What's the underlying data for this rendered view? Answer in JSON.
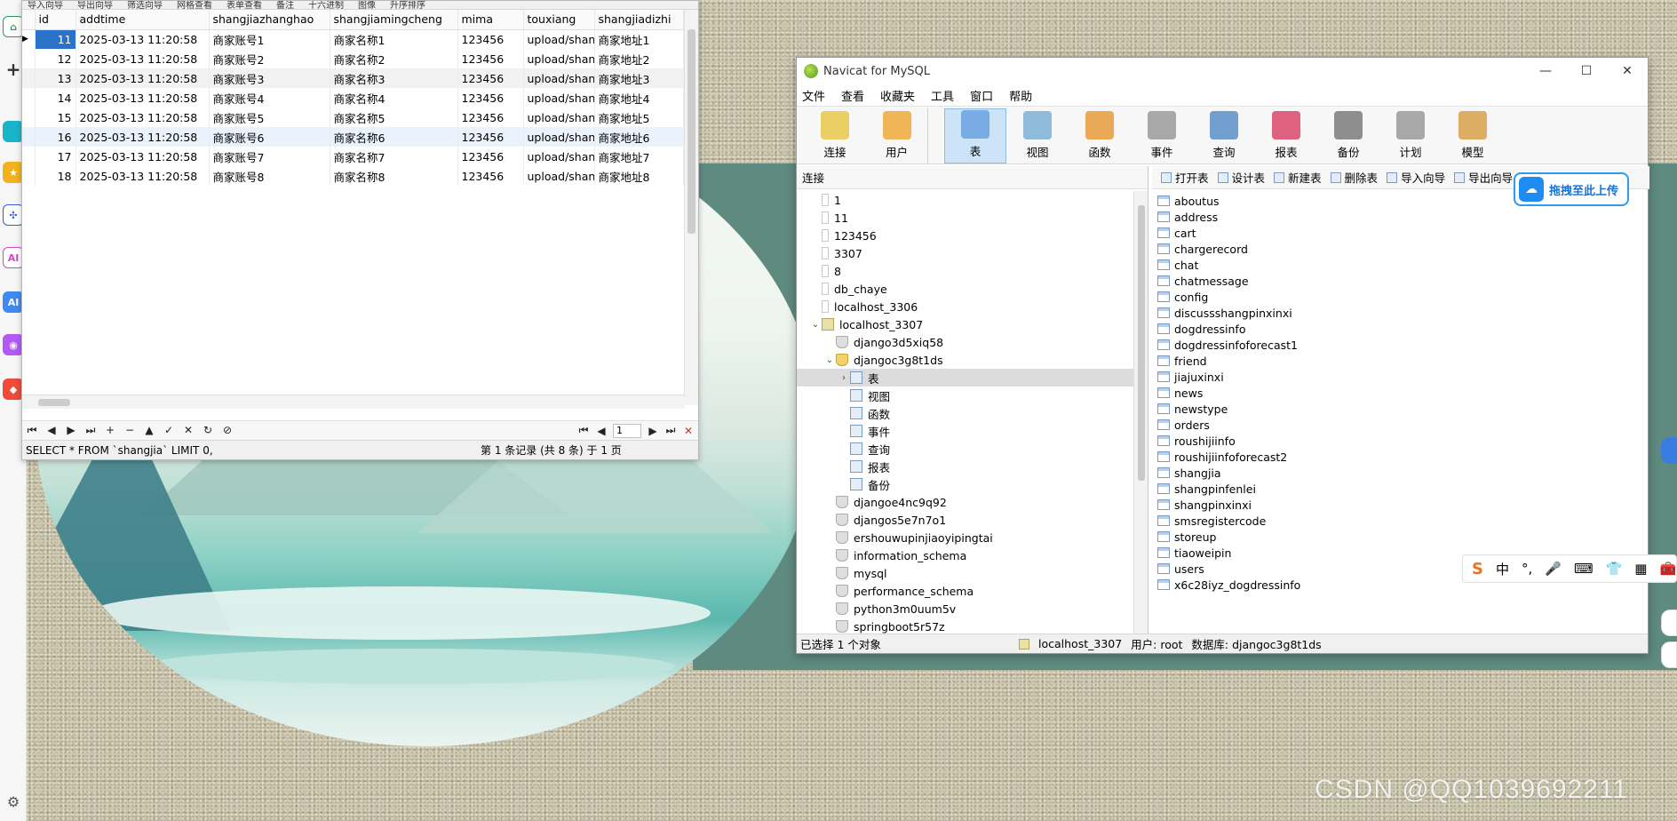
{
  "grid_window": {
    "top_toolbar": [
      "导入向导",
      "导出向导",
      "筛选向导",
      "网格查看",
      "表单查看",
      "备注",
      "十六进制",
      "图像",
      "升序排序"
    ],
    "columns": [
      "id",
      "addtime",
      "shangjiazhanghao",
      "shangjiamingcheng",
      "mima",
      "touxiang",
      "shangjiadizhi"
    ],
    "rows": [
      [
        "11",
        "2025-03-13 11:20:58",
        "商家账号1",
        "商家名称1",
        "123456",
        "upload/shang",
        "商家地址1"
      ],
      [
        "12",
        "2025-03-13 11:20:58",
        "商家账号2",
        "商家名称2",
        "123456",
        "upload/shang",
        "商家地址2"
      ],
      [
        "13",
        "2025-03-13 11:20:58",
        "商家账号3",
        "商家名称3",
        "123456",
        "upload/shang",
        "商家地址3"
      ],
      [
        "14",
        "2025-03-13 11:20:58",
        "商家账号4",
        "商家名称4",
        "123456",
        "upload/shang",
        "商家地址4"
      ],
      [
        "15",
        "2025-03-13 11:20:58",
        "商家账号5",
        "商家名称5",
        "123456",
        "upload/shang",
        "商家地址5"
      ],
      [
        "16",
        "2025-03-13 11:20:58",
        "商家账号6",
        "商家名称6",
        "123456",
        "upload/shang",
        "商家地址6"
      ],
      [
        "17",
        "2025-03-13 11:20:58",
        "商家账号7",
        "商家名称7",
        "123456",
        "upload/shang",
        "商家地址7"
      ],
      [
        "18",
        "2025-03-13 11:20:58",
        "商家账号8",
        "商家名称8",
        "123456",
        "upload/shang",
        "商家地址8"
      ]
    ],
    "nav_buttons": [
      "⏮",
      "◀",
      "▶",
      "⏭",
      "+",
      "−",
      "▲",
      "✓",
      "✕",
      "↻",
      "⊘"
    ],
    "page_input": "1",
    "sql": "SELECT * FROM `shangjia` LIMIT 0,",
    "record_info": "第 1 条记录 (共 8 条) 于 1 页"
  },
  "navicat": {
    "title": "Navicat for MySQL",
    "window_controls": [
      "—",
      "☐",
      "✕"
    ],
    "menu": [
      "文件",
      "查看",
      "收藏夹",
      "工具",
      "窗口",
      "帮助"
    ],
    "toolbar": [
      {
        "label": "连接",
        "icon": "connection-icon"
      },
      {
        "label": "用户",
        "icon": "user-icon"
      },
      {
        "label": "表",
        "icon": "table-icon"
      },
      {
        "label": "视图",
        "icon": "view-icon"
      },
      {
        "label": "函数",
        "icon": "function-icon"
      },
      {
        "label": "事件",
        "icon": "event-icon"
      },
      {
        "label": "查询",
        "icon": "query-icon"
      },
      {
        "label": "报表",
        "icon": "report-icon"
      },
      {
        "label": "备份",
        "icon": "backup-icon"
      },
      {
        "label": "计划",
        "icon": "schedule-icon"
      },
      {
        "label": "模型",
        "icon": "model-icon"
      }
    ],
    "left_header": "连接",
    "tree": [
      {
        "label": "1",
        "kind": "plain",
        "indent": 0,
        "arrow": ""
      },
      {
        "label": "11",
        "kind": "plain",
        "indent": 0,
        "arrow": ""
      },
      {
        "label": "123456",
        "kind": "plain",
        "indent": 0,
        "arrow": ""
      },
      {
        "label": "3307",
        "kind": "plain",
        "indent": 0,
        "arrow": ""
      },
      {
        "label": "8",
        "kind": "plain",
        "indent": 0,
        "arrow": ""
      },
      {
        "label": "db_chaye",
        "kind": "plain",
        "indent": 0,
        "arrow": ""
      },
      {
        "label": "localhost_3306",
        "kind": "plain",
        "indent": 0,
        "arrow": ""
      },
      {
        "label": "localhost_3307",
        "kind": "conn",
        "indent": 0,
        "arrow": "⌄"
      },
      {
        "label": "django3d5xiq58",
        "kind": "db",
        "indent": 1,
        "arrow": ""
      },
      {
        "label": "djangoc3g8t1ds",
        "kind": "dbopen",
        "indent": 1,
        "arrow": "⌄"
      },
      {
        "label": "表",
        "kind": "table",
        "indent": 2,
        "arrow": "›"
      },
      {
        "label": "视图",
        "kind": "view",
        "indent": 2,
        "arrow": ""
      },
      {
        "label": "函数",
        "kind": "func",
        "indent": 2,
        "arrow": ""
      },
      {
        "label": "事件",
        "kind": "event",
        "indent": 2,
        "arrow": ""
      },
      {
        "label": "查询",
        "kind": "query",
        "indent": 2,
        "arrow": ""
      },
      {
        "label": "报表",
        "kind": "report",
        "indent": 2,
        "arrow": ""
      },
      {
        "label": "备份",
        "kind": "backup",
        "indent": 2,
        "arrow": ""
      },
      {
        "label": "djangoe4nc9q92",
        "kind": "db",
        "indent": 1,
        "arrow": ""
      },
      {
        "label": "djangos5e7n7o1",
        "kind": "db",
        "indent": 1,
        "arrow": ""
      },
      {
        "label": "ershouwupinjiaoyipingtai",
        "kind": "db",
        "indent": 1,
        "arrow": ""
      },
      {
        "label": "information_schema",
        "kind": "db",
        "indent": 1,
        "arrow": ""
      },
      {
        "label": "mysql",
        "kind": "db",
        "indent": 1,
        "arrow": ""
      },
      {
        "label": "performance_schema",
        "kind": "db",
        "indent": 1,
        "arrow": ""
      },
      {
        "label": "python3m0uum5v",
        "kind": "db",
        "indent": 1,
        "arrow": ""
      },
      {
        "label": "springboot5r57z",
        "kind": "db",
        "indent": 1,
        "arrow": ""
      }
    ],
    "object_toolbar": [
      "打开表",
      "设计表",
      "新建表",
      "删除表",
      "导入向导",
      "导出向导"
    ],
    "tables": [
      "aboutus",
      "address",
      "cart",
      "chargerecord",
      "chat",
      "chatmessage",
      "config",
      "discussshangpinxinxi",
      "dogdressinfo",
      "dogdressinfoforecast1",
      "friend",
      "jiajuxinxi",
      "news",
      "newstype",
      "orders",
      "roushijiinfo",
      "roushijiinfoforecast2",
      "shangjia",
      "shangpinfenlei",
      "shangpinxinxi",
      "smsregistercode",
      "storeup",
      "tiaoweipin",
      "users",
      "x6c28iyz_dogdressinfo"
    ],
    "status": {
      "selected": "已选择 1 个对象",
      "connection": "localhost_3307",
      "user": "用户: root",
      "database": "数据库: djangoc3g8t1ds"
    }
  },
  "upload_bubble": {
    "label": "拖拽至此上传"
  },
  "ime_bar": {
    "items": [
      "S",
      "中",
      "°,",
      "🎤",
      "⌨",
      "👕",
      "▦",
      "🧰"
    ]
  },
  "watermark": "CSDN @QQ1039692211",
  "colors": {
    "selection_blue": "#2a73c9",
    "navicat_active_tool": "#cde3f7",
    "green_band": "#5f8a80"
  }
}
